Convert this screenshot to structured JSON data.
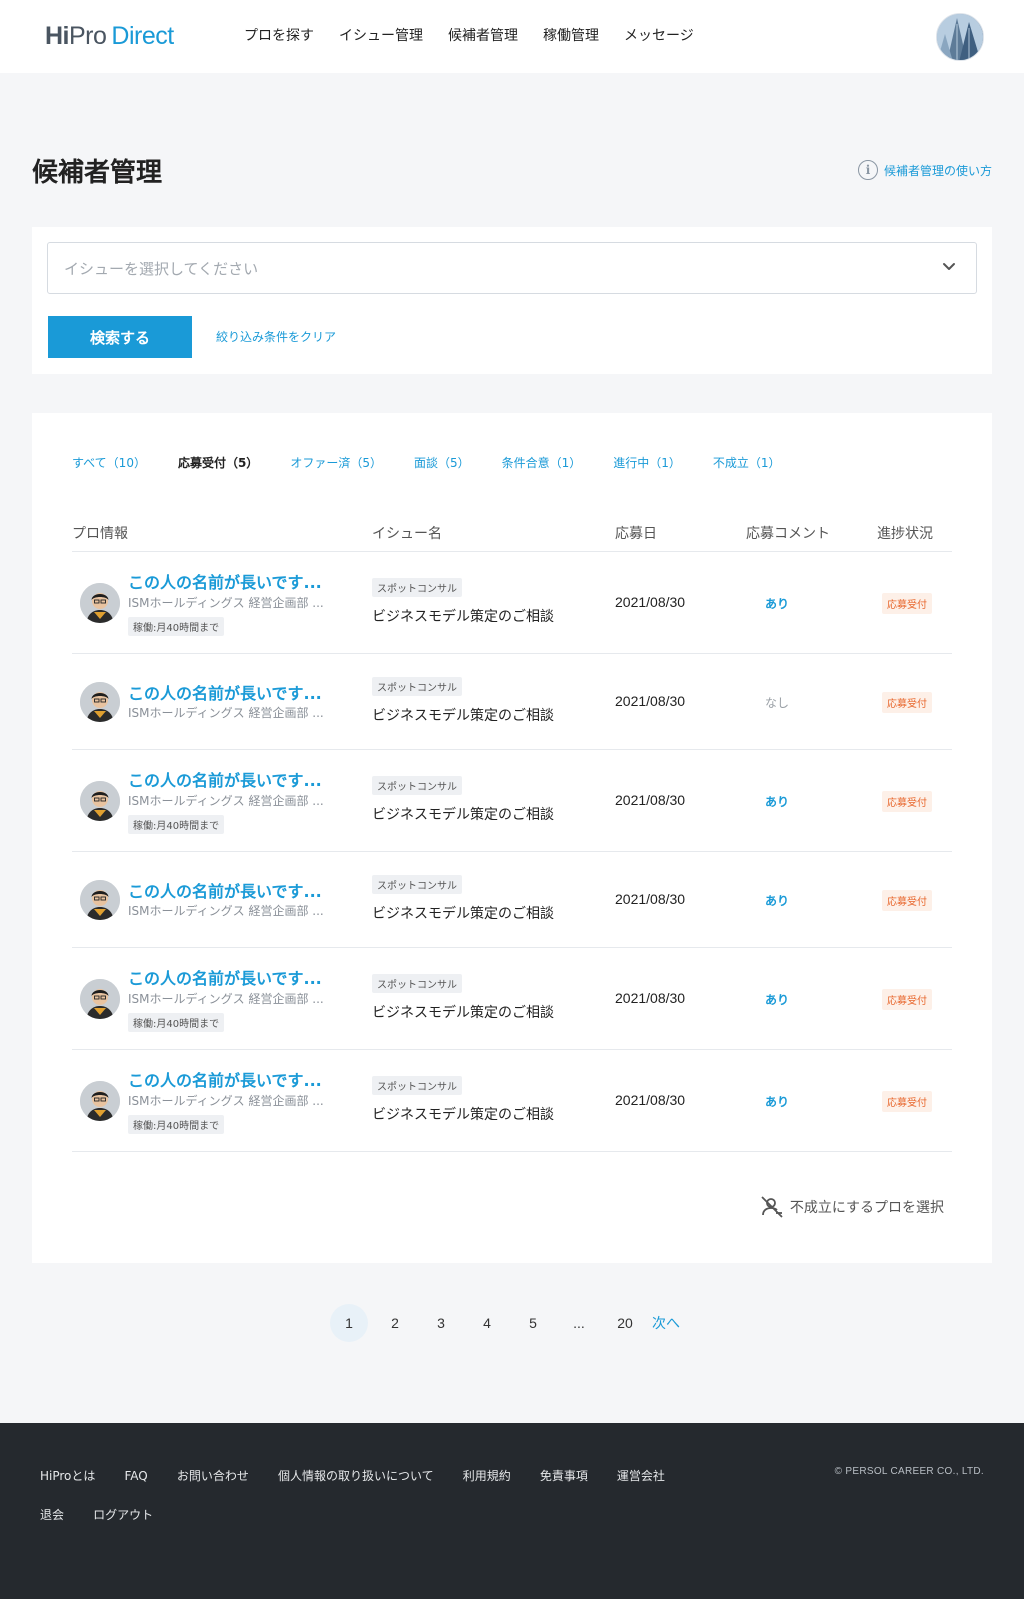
{
  "header": {
    "logo": {
      "hi": "Hi",
      "pro": "Pro",
      "direct": "Direct"
    },
    "nav": [
      "プロを探す",
      "イシュー管理",
      "候補者管理",
      "稼働管理",
      "メッセージ"
    ]
  },
  "page": {
    "title": "候補者管理",
    "help_link": "候補者管理の使い方"
  },
  "filter": {
    "issue_placeholder": "イシューを選択してください",
    "search_label": "検索する",
    "clear_label": "絞り込み条件をクリア"
  },
  "tabs": [
    {
      "label": "すべて（10）",
      "active": false
    },
    {
      "label": "応募受付（5）",
      "active": true
    },
    {
      "label": "オファー済（5）",
      "active": false
    },
    {
      "label": "面談（5）",
      "active": false
    },
    {
      "label": "条件合意（1）",
      "active": false
    },
    {
      "label": "進行中（1）",
      "active": false
    },
    {
      "label": "不成立（1）",
      "active": false
    }
  ],
  "table": {
    "headers": {
      "pro": "プロ情報",
      "issue": "イシュー名",
      "date": "応募日",
      "comment": "応募コメント",
      "status": "進捗状況"
    },
    "rows": [
      {
        "name": "この人の名前が長いです...",
        "company": "ISMホールディングス 経営企画部 ...",
        "hours": "稼働:月40時間まで",
        "tag": "スポットコンサル",
        "issue": "ビジネスモデル策定のご相談",
        "date": "2021/08/30",
        "comment": "あり",
        "status": "応募受付"
      },
      {
        "name": "この人の名前が長いです...",
        "company": "ISMホールディングス 経営企画部 ...",
        "hours": "",
        "tag": "スポットコンサル",
        "issue": "ビジネスモデル策定のご相談",
        "date": "2021/08/30",
        "comment": "なし",
        "status": "応募受付"
      },
      {
        "name": "この人の名前が長いです...",
        "company": "ISMホールディングス 経営企画部 ...",
        "hours": "稼働:月40時間まで",
        "tag": "スポットコンサル",
        "issue": "ビジネスモデル策定のご相談",
        "date": "2021/08/30",
        "comment": "あり",
        "status": "応募受付"
      },
      {
        "name": "この人の名前が長いです...",
        "company": "ISMホールディングス 経営企画部 ...",
        "hours": "",
        "tag": "スポットコンサル",
        "issue": "ビジネスモデル策定のご相談",
        "date": "2021/08/30",
        "comment": "あり",
        "status": "応募受付"
      },
      {
        "name": "この人の名前が長いです...",
        "company": "ISMホールディングス 経営企画部 ...",
        "hours": "稼働:月40時間まで",
        "tag": "スポットコンサル",
        "issue": "ビジネスモデル策定のご相談",
        "date": "2021/08/30",
        "comment": "あり",
        "status": "応募受付"
      },
      {
        "name": "この人の名前が長いです...",
        "company": "ISMホールディングス 経営企画部 ...",
        "hours": "稼働:月40時間まで",
        "tag": "スポットコンサル",
        "issue": "ビジネスモデル策定のご相談",
        "date": "2021/08/30",
        "comment": "あり",
        "status": "応募受付"
      }
    ]
  },
  "reject_link": "不成立にするプロを選択",
  "pagination": {
    "pages": [
      "1",
      "2",
      "3",
      "4",
      "5",
      "...",
      "20"
    ],
    "current": "1",
    "next": "次へ"
  },
  "footer": {
    "links": [
      "HiProとは",
      "FAQ",
      "お問い合わせ",
      "個人情報の取り扱いについて",
      "利用規約",
      "免責事項",
      "運営会社",
      "退会",
      "ログアウト"
    ],
    "copyright": "© PERSOL CAREER CO., LTD."
  },
  "colors": {
    "accent": "#1a9ad7",
    "status_badge_text": "#e8662c",
    "status_badge_bg": "#fdf0e8",
    "footer_bg": "#25292e",
    "page_bg": "#f5f6f8"
  },
  "icons": [
    "chevron-down-icon",
    "info-icon",
    "person-remove-icon",
    "avatar-icon"
  ]
}
